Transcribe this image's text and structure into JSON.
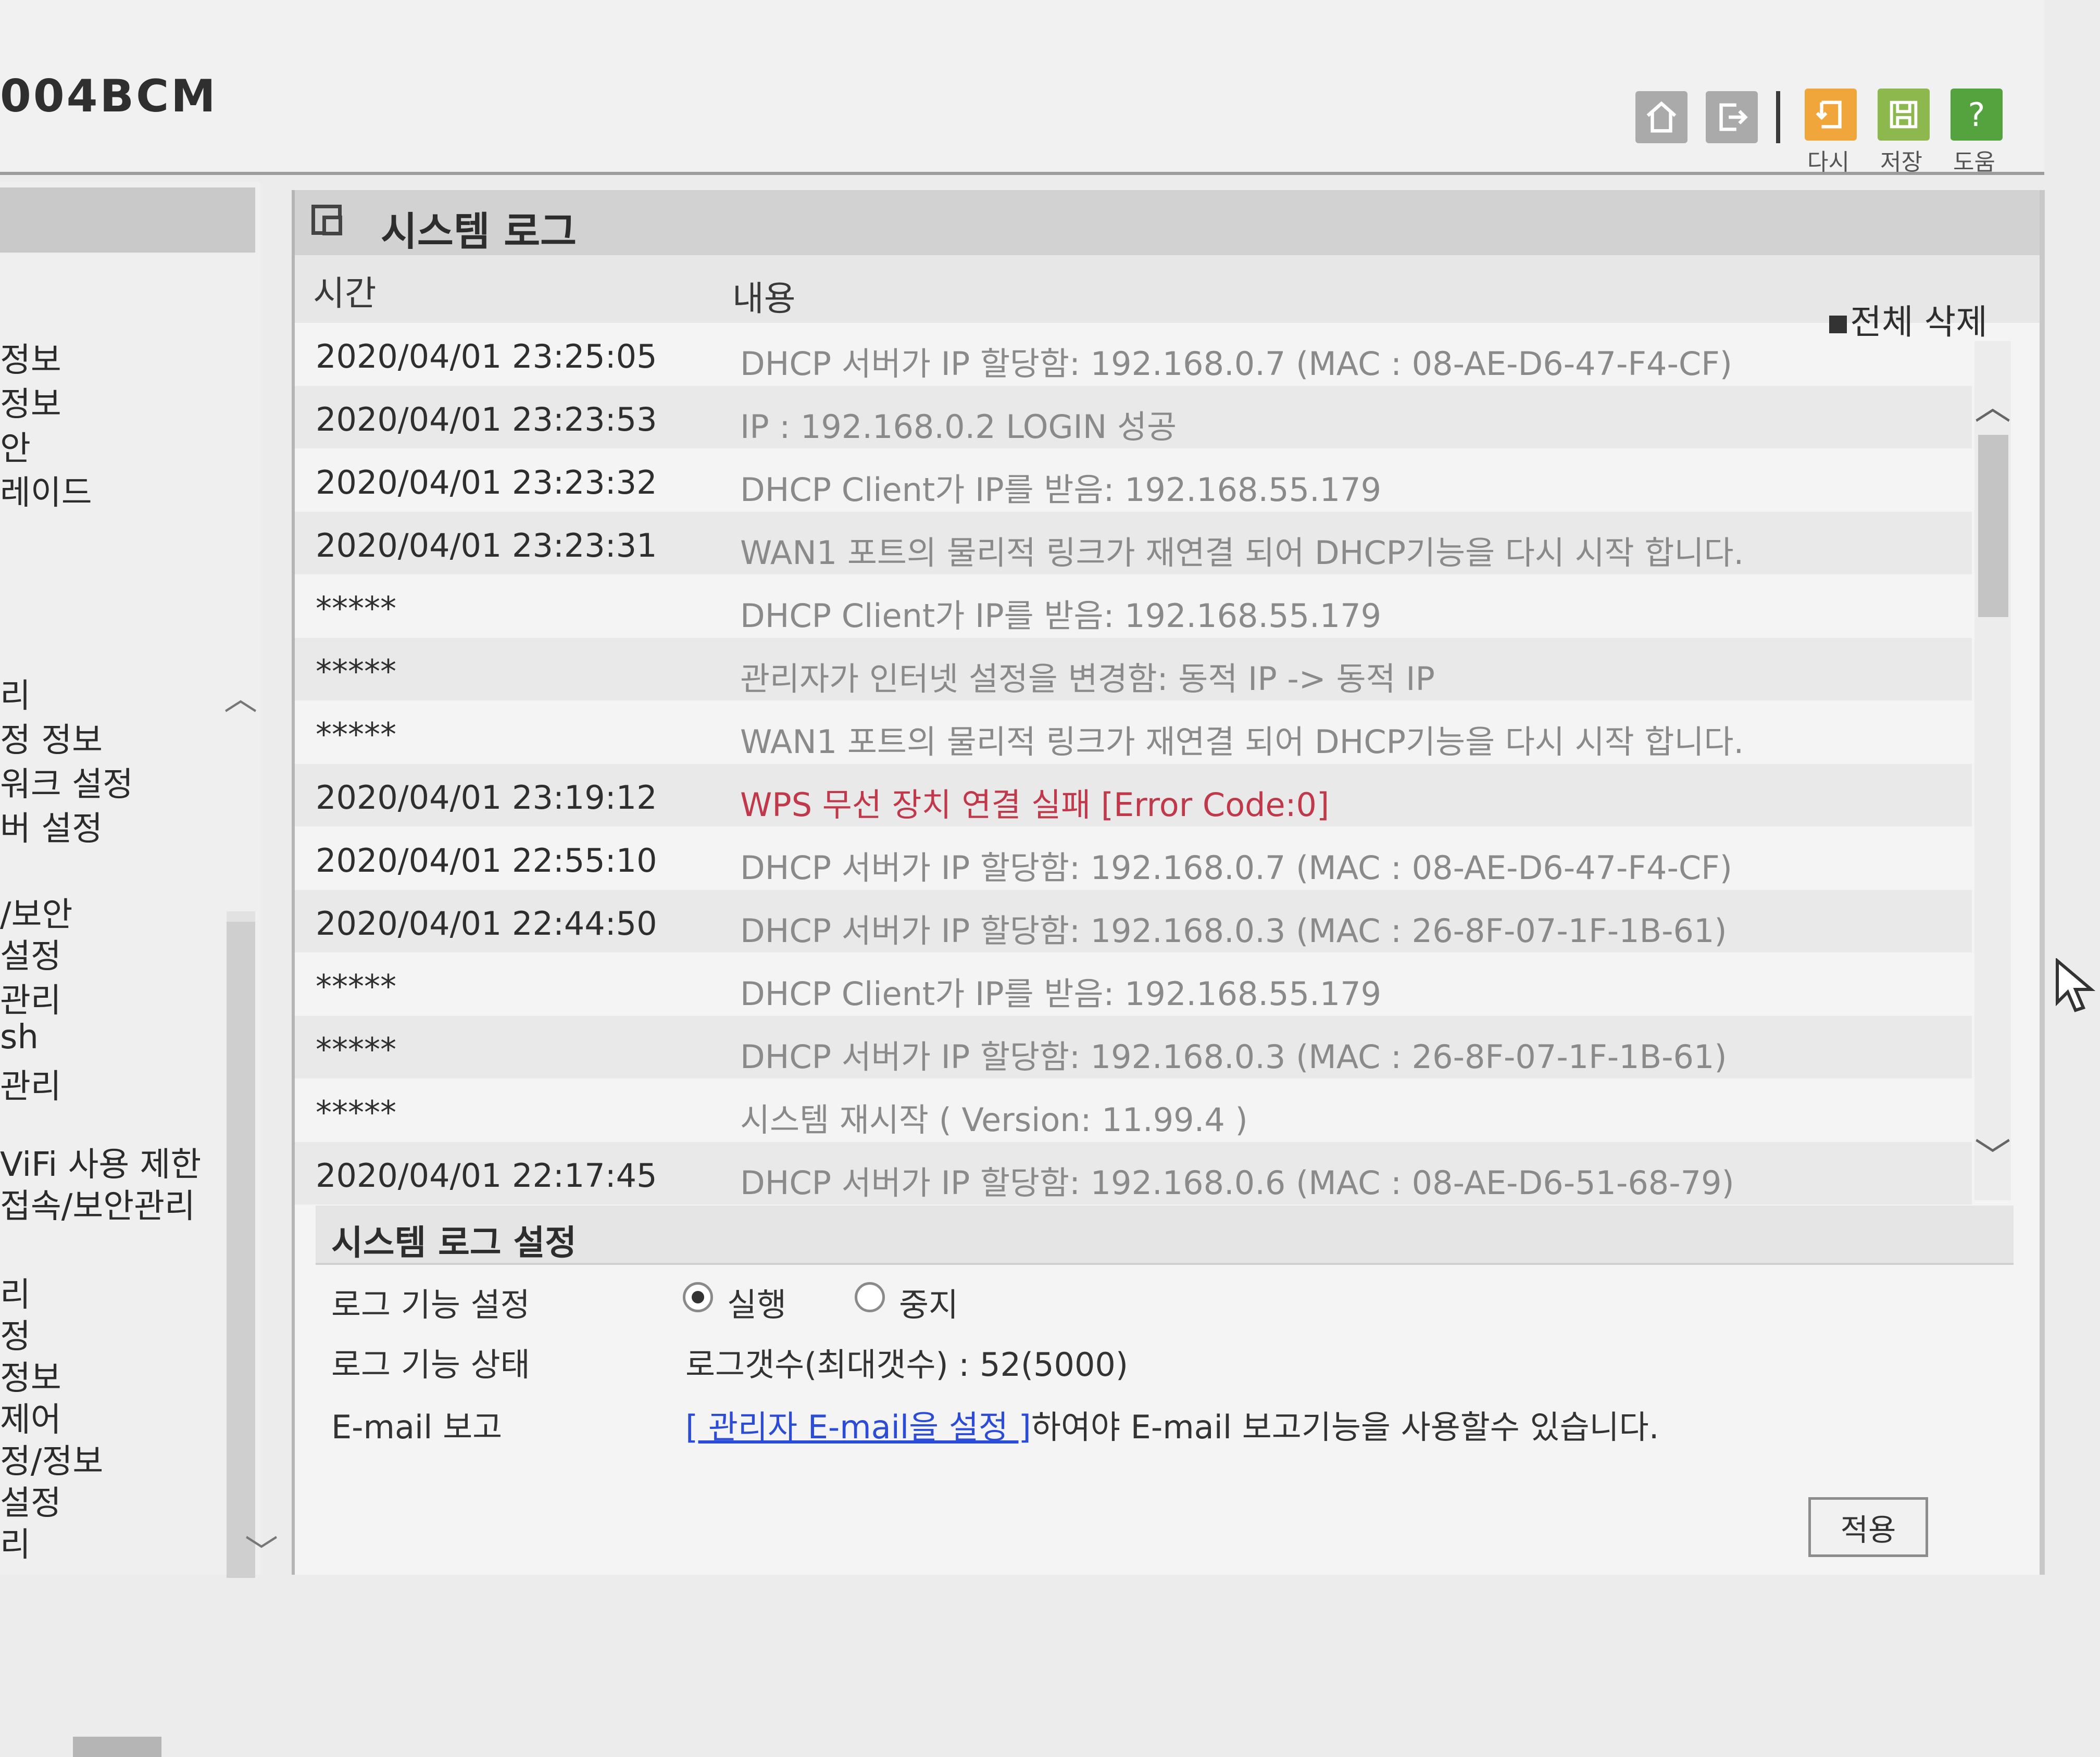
{
  "header": {
    "model": "004BCM",
    "toolbar": {
      "home_icon": "home-icon",
      "logout_icon": "logout-icon",
      "restart_label": "다시",
      "save_label": "저장",
      "help_label": "도움",
      "help_glyph": "?"
    }
  },
  "sidebar": {
    "items": [
      "정보",
      "정보",
      "안",
      "레이드",
      "리",
      "정 정보",
      "워크 설정",
      "버 설정",
      "/보안",
      "설정",
      "관리",
      "sh",
      "관리",
      "ViFi 사용 제한",
      "접속/보안관리",
      "리",
      "정",
      "정보",
      "제어",
      "정/정보",
      "설정",
      "리"
    ]
  },
  "panel": {
    "title": "시스템 로그",
    "columns": {
      "time": "시간",
      "content": "내용"
    },
    "delete_all": "전체 삭제",
    "logs": [
      {
        "time": "2020/04/01 23:25:05",
        "message": "DHCP 서버가 IP 할당함: 192.168.0.7 (MAC : 08-AE-D6-47-F4-CF)"
      },
      {
        "time": "2020/04/01 23:23:53",
        "message": "IP : 192.168.0.2 LOGIN 성공"
      },
      {
        "time": "2020/04/01 23:23:32",
        "message": "DHCP Client가 IP를 받음: 192.168.55.179"
      },
      {
        "time": "2020/04/01 23:23:31",
        "message": "WAN1 포트의 물리적 링크가 재연결 되어 DHCP기능을 다시 시작 합니다."
      },
      {
        "time": "*****",
        "message": "DHCP Client가 IP를 받음: 192.168.55.179"
      },
      {
        "time": "*****",
        "message": "관리자가 인터넷 설정을 변경함: 동적 IP -> 동적 IP"
      },
      {
        "time": "*****",
        "message": "WAN1 포트의 물리적 링크가 재연결 되어 DHCP기능을 다시 시작 합니다."
      },
      {
        "time": "2020/04/01 23:19:12",
        "message": "WPS 무선 장치 연결 실패 [Error Code:0]"
      },
      {
        "time": "2020/04/01 22:55:10",
        "message": "DHCP 서버가 IP 할당함: 192.168.0.7 (MAC : 08-AE-D6-47-F4-CF)"
      },
      {
        "time": "2020/04/01 22:44:50",
        "message": "DHCP 서버가 IP 할당함: 192.168.0.3 (MAC : 26-8F-07-1F-1B-61)"
      },
      {
        "time": "*****",
        "message": "DHCP Client가 IP를 받음: 192.168.55.179"
      },
      {
        "time": "*****",
        "message": "DHCP 서버가 IP 할당함: 192.168.0.3 (MAC : 26-8F-07-1F-1B-61)"
      },
      {
        "time": "*****",
        "message": "시스템 재시작 ( Version: 11.99.4 )"
      },
      {
        "time": "2020/04/01 22:17:45",
        "message": "DHCP 서버가 IP 할당함: 192.168.0.6 (MAC : 08-AE-D6-51-68-79)"
      }
    ],
    "colors": {
      "error": "#c0394b",
      "link": "#2c4bd6"
    }
  },
  "settings": {
    "title": "시스템 로그 설정",
    "log_function": {
      "label": "로그 기능 설정",
      "options": [
        "실행",
        "중지"
      ],
      "selected": "실행"
    },
    "log_status": {
      "label": "로그 기능 상태",
      "value": "로그갯수(최대갯수) : 52(5000)"
    },
    "email": {
      "label": "E-mail 보고",
      "link": "[ 관리자 E-mail을 설정 ]",
      "suffix": "하여야 E-mail 보고기능을 사용할수 있습니다."
    },
    "apply_label": "적용"
  }
}
